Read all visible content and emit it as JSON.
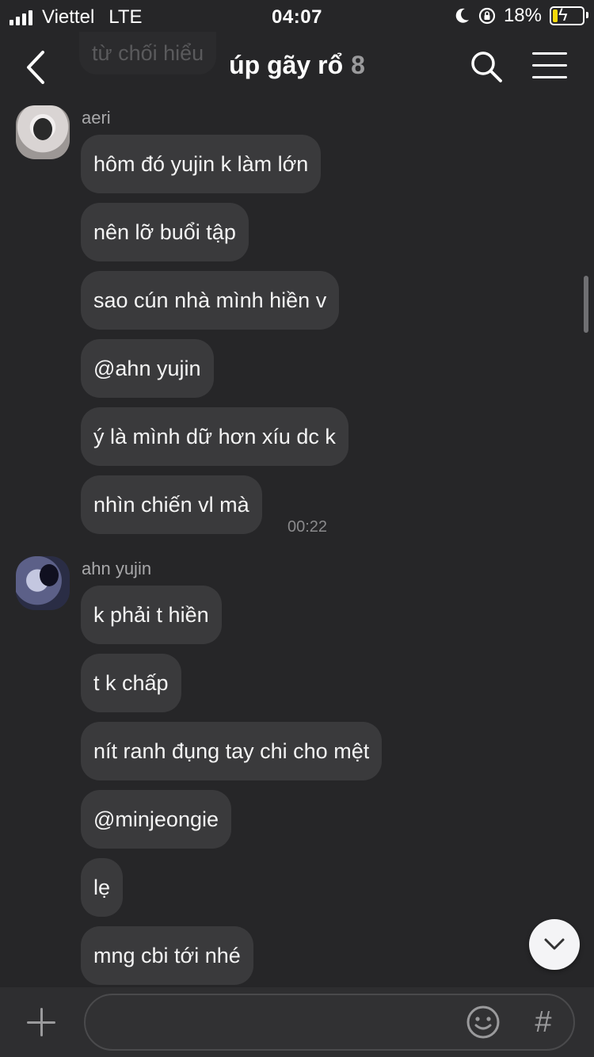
{
  "status_bar": {
    "carrier": "Viettel",
    "network": "LTE",
    "time": "04:07",
    "battery": "18%",
    "battery_level": 0.18,
    "icons": [
      "signal-icon",
      "moon-icon",
      "orientation-lock-icon",
      "battery-charging-icon"
    ]
  },
  "header": {
    "ghost_text": "từ chối hiểu",
    "title": "úp gãy rổ",
    "member_count": "8",
    "icons": [
      "back-icon",
      "search-icon",
      "menu-icon"
    ]
  },
  "messages": {
    "group1": {
      "sender": "aeri",
      "items": [
        "hôm đó yujin k làm lớn",
        "nên lỡ buổi tập",
        "sao cún nhà mình hiền v",
        "@ahn yujin",
        "ý là mình dữ hơn xíu dc k",
        "nhìn chiến vl mà"
      ],
      "time": "00:22"
    },
    "group2": {
      "sender": "ahn yujin",
      "items": [
        "k phải t hiền",
        "t k chấp",
        "nít ranh đụng tay chi cho mệt",
        "@minjeongie",
        "lẹ",
        "mng cbi tới nhé"
      ]
    }
  },
  "composer": {
    "placeholder": "",
    "icons": [
      "add-icon",
      "emoji-icon",
      "hashtag-icon"
    ],
    "hash_symbol": "#"
  },
  "colors": {
    "background": "#262628",
    "bubble": "#3a3a3c",
    "battery_fill": "#f5d90a"
  }
}
